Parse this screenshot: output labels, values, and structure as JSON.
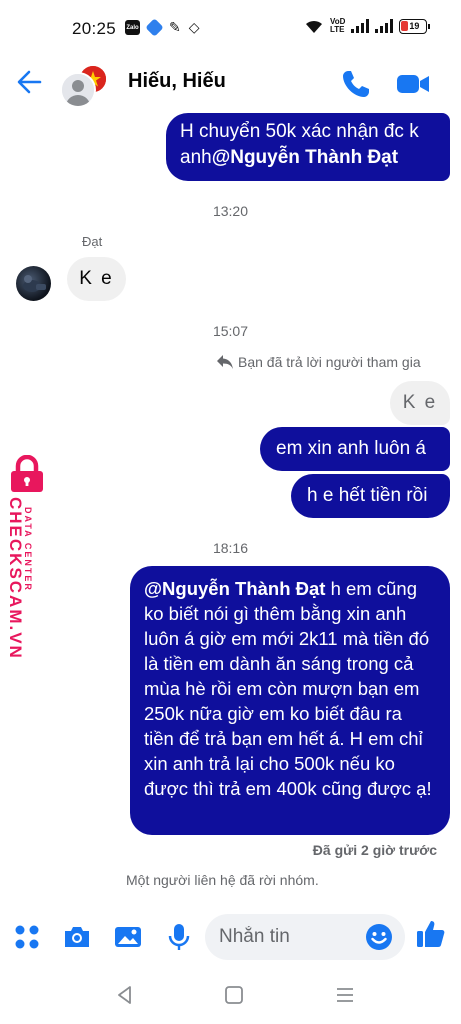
{
  "status_bar": {
    "time": "20:25",
    "zalo_label": "Zalo",
    "volte_top": "VoD",
    "volte_bottom": "LTE",
    "battery": "19"
  },
  "header": {
    "title": "Hiếu, Hiếu"
  },
  "messages": {
    "m1_line1": "H chuyển 50k xác nhận đc k",
    "m1_line2_prefix": "anh",
    "m1_mention": "@Nguyễn Thành Đạt",
    "time1": "13:20",
    "sender_name": "Đạt",
    "m2": "K e",
    "time2": "15:07",
    "reply_note": "Bạn đã trả lời người tham gia",
    "m3": "K e",
    "m4": "em xin anh luôn á",
    "m5": "h e hết tiền rồi",
    "time3": "18:16",
    "m6_mention": "@Nguyễn Thành Đạt",
    "m6_text": " h em cũng ko biết nói gì thêm bằng xin anh luôn á giờ em mới 2k11 mà tiền đó là tiền em dành ăn sáng trong cả mùa hè rồi em còn mượn bạn em 250k nữa giờ em ko biết đâu ra tiền để trả bạn em hết á. H em chỉ xin anh trả lại cho 500k nếu ko được thì trả em 400k cũng được ạ!",
    "sent_status": "Đã gửi 2 giờ trước",
    "left_note": "Một người liên hệ đã rời nhóm."
  },
  "watermark": {
    "subtitle": "DATA CENTER",
    "brand": "CHECKSCAM.VN"
  },
  "composer": {
    "placeholder": "Nhắn tin"
  },
  "colors": {
    "accent": "#1877f2",
    "outgoing_bubble": "#0f0f9c",
    "incoming_bubble": "#f0f0f0",
    "watermark": "#e8175d"
  },
  "icons": [
    "back-arrow-icon",
    "phone-icon",
    "video-camera-icon",
    "reply-icon",
    "menu-dots-icon",
    "camera-icon",
    "image-icon",
    "microphone-icon",
    "emoji-icon",
    "thumbs-up-icon",
    "nav-back-icon",
    "nav-home-icon",
    "nav-recents-icon"
  ]
}
